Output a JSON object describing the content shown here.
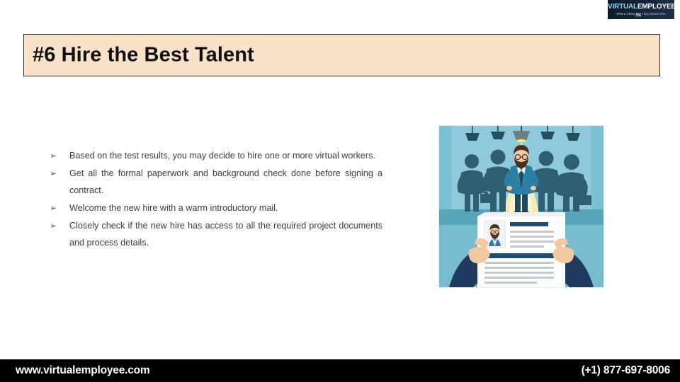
{
  "slide": {
    "background_color": "#ffffff"
  },
  "logo": {
    "word_primary": "VIRTUAL",
    "word_secondary": "EMPLOYEE",
    "tagline_before": "- Where CEOs ",
    "tagline_emphasis": "Say",
    "tagline_after": " They Saved 70% -",
    "primary_color": "#8fd3e8",
    "secondary_color": "#ffffff",
    "background_color": "#0d1b2a"
  },
  "title": {
    "text": "#6 Hire the Best Talent",
    "background_color": "#fae2c8",
    "border_color": "#2a2a2a",
    "text_color": "#101010"
  },
  "bullets": {
    "glyph": "➢",
    "items": [
      {
        "text": "Based on the test results, you may decide to hire one or more virtual workers."
      },
      {
        "text": "Get all the formal paperwork and background check done before signing a contract."
      },
      {
        "text": "Welcome the new hire with a warm introductory mail."
      },
      {
        "text": "Closely check if the new hire has access to all the required project documents and process details."
      }
    ]
  },
  "illustration": {
    "alt": "Recruiter hands holding a resume in front of candidate silhouettes with one highlighted under a spotlight",
    "colors": {
      "wall": "#8ec9dc",
      "floor": "#5aa7bb",
      "silhouette": "#2d5f6e",
      "spotlight": "#f7e9a8",
      "suit": "#1f6f96",
      "skin": "#f0c9a0",
      "paper": "#ffffff",
      "accent": "#1f4e79"
    }
  },
  "footer": {
    "website": "www.virtualemployee.com",
    "phone": "(+1) 877-697-8006",
    "background_color": "#000000",
    "text_color": "#ffffff"
  }
}
